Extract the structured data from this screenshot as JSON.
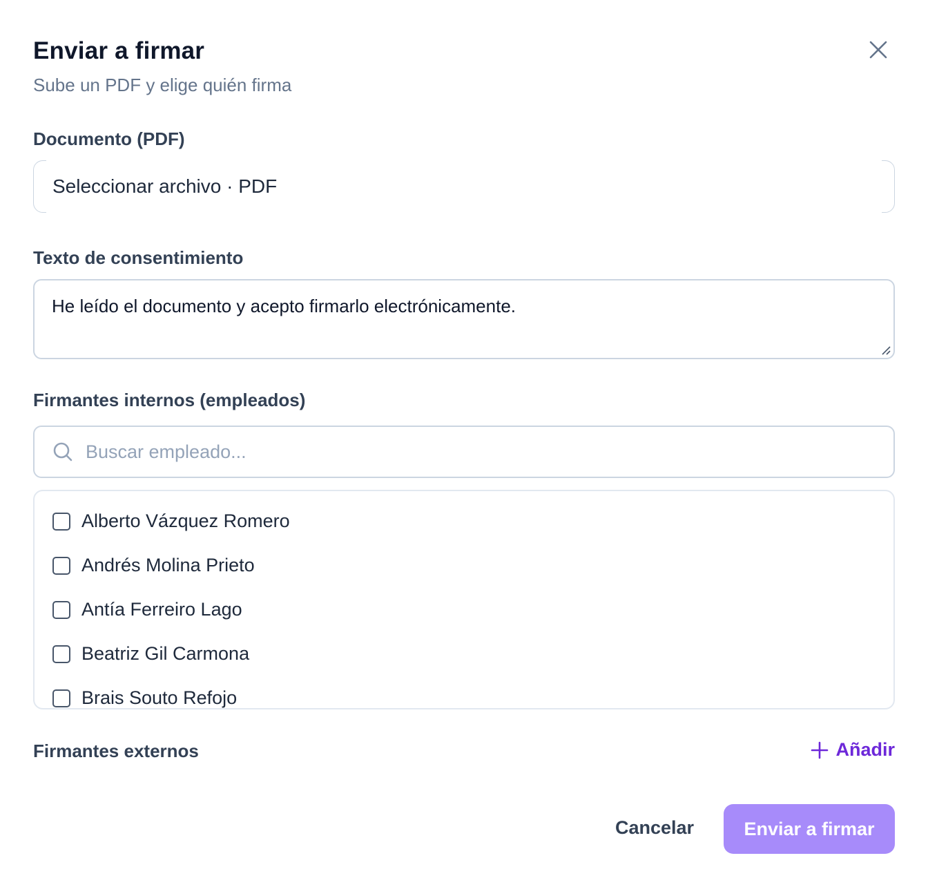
{
  "dialog": {
    "title": "Enviar a firmar",
    "subtitle": "Sube un PDF y elige quién firma",
    "close_icon": "close-icon"
  },
  "document": {
    "label": "Documento (PDF)",
    "file_button_text": "Seleccionar archivo · PDF"
  },
  "consent": {
    "label": "Texto de consentimiento",
    "value": "He leído el documento y acepto firmarlo electrónicamente."
  },
  "internal_signers": {
    "label": "Firmantes internos (empleados)",
    "search_placeholder": "Buscar empleado...",
    "search_icon": "search-icon",
    "employees": [
      {
        "name": "Alberto Vázquez Romero",
        "checked": false
      },
      {
        "name": "Andrés Molina Prieto",
        "checked": false
      },
      {
        "name": "Antía Ferreiro Lago",
        "checked": false
      },
      {
        "name": "Beatriz Gil Carmona",
        "checked": false
      },
      {
        "name": "Brais Souto Refojo",
        "checked": false
      }
    ]
  },
  "external_signers": {
    "label": "Firmantes externos",
    "add_label": "Añadir",
    "add_icon": "plus-icon"
  },
  "footer": {
    "cancel_label": "Cancelar",
    "submit_label": "Enviar a firmar"
  },
  "colors": {
    "accent": "#6d28d9",
    "submit_bg": "#a78bfa",
    "border": "#cbd5e1",
    "muted_text": "#64748b"
  }
}
